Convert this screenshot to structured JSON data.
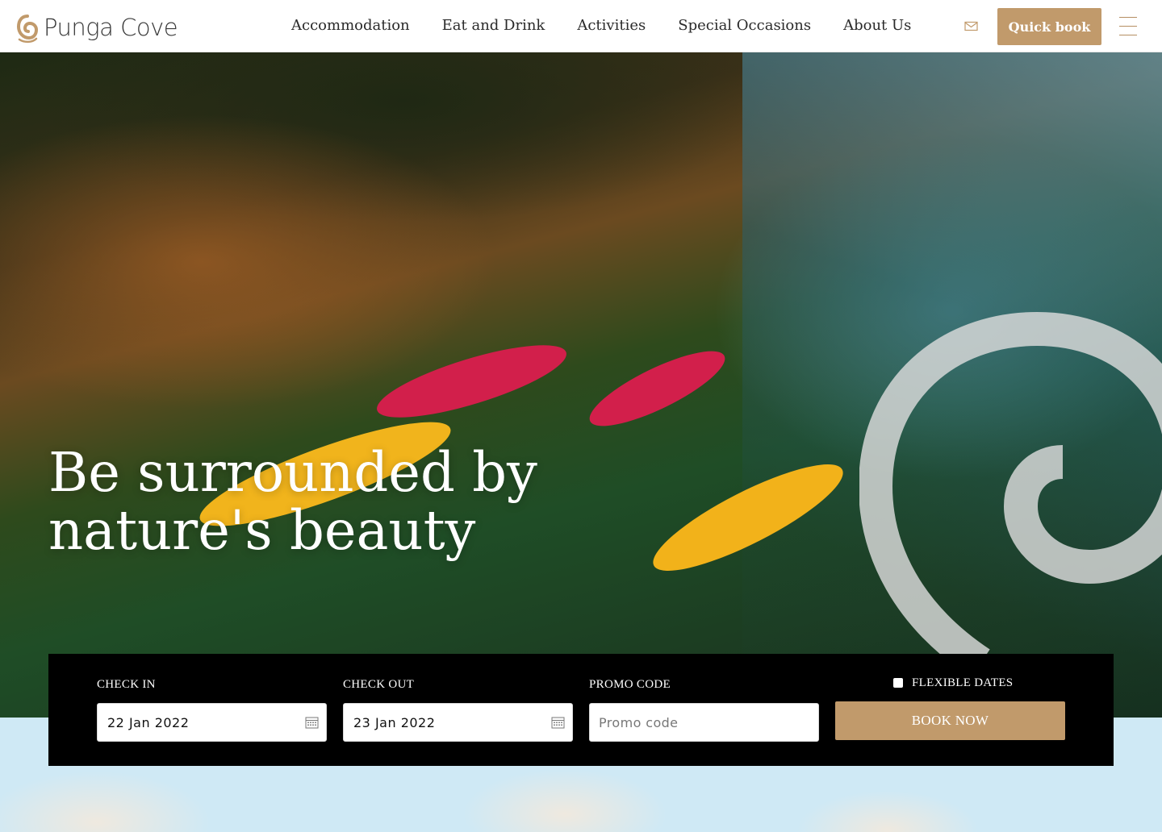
{
  "header": {
    "logo_text": "Punga Cove",
    "nav": [
      {
        "label": "Accommodation"
      },
      {
        "label": "Eat and Drink"
      },
      {
        "label": "Activities"
      },
      {
        "label": "Special Occasions"
      },
      {
        "label": "About Us"
      }
    ],
    "quick_book_label": "Quick book"
  },
  "hero": {
    "heading_line1": "Be surrounded by",
    "heading_line2": "nature's beauty"
  },
  "booking": {
    "check_in_label": "CHECK IN",
    "check_in_value": "22 Jan 2022",
    "check_out_label": "CHECK OUT",
    "check_out_value": "23 Jan 2022",
    "promo_label": "PROMO CODE",
    "promo_placeholder": "Promo code",
    "flexible_label": "FLEXIBLE DATES",
    "flexible_checked": false,
    "book_now_label": "BOOK NOW"
  },
  "colors": {
    "accent": "#c19a6b",
    "booking_bar": "#000000",
    "hero_text": "#ffffff"
  },
  "icons": [
    "logo-swirl-icon",
    "mail-icon",
    "hamburger-menu-icon",
    "calendar-icon",
    "koru-swirl-decoration"
  ]
}
